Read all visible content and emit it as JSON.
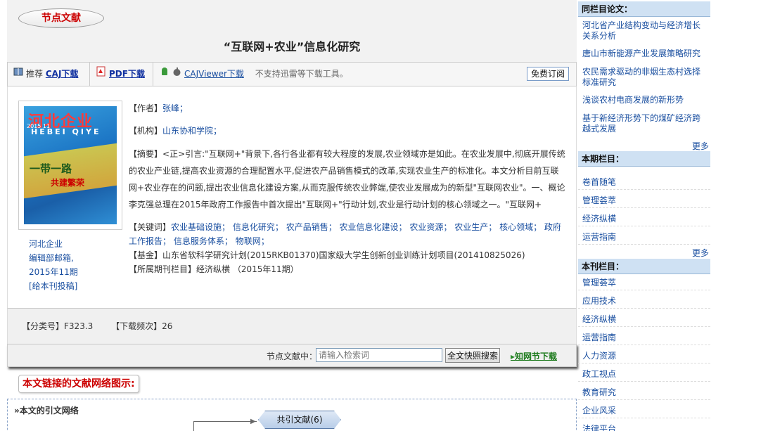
{
  "header": {
    "badge": "节点文献",
    "title": "“互联网+农业”信息化研究"
  },
  "toolbar": {
    "recommend_label": "推荐",
    "caj_download": "CAJ下载",
    "pdf_download": "PDF下载",
    "cajviewer_download": "CAJViewer下载",
    "note": "不支持迅雷等下载工具。",
    "subscribe": "免费订阅"
  },
  "detail": {
    "author_label": "【作者】",
    "author": "张峰；",
    "org_label": "【机构】",
    "org": "山东协和学院；",
    "abstract_label": "【摘要】",
    "abstract": "<正>引言:\"互联网+\"背景下,各行各业都有较大程度的发展,农业领域亦是如此。在农业发展中,彻底开展传统的农业产业链,提高农业资源的合理配置水平,促进农产品销售模式的改革,实现农业生产的标准化。本文分析目前互联网+农业存在的问题,提出农业信息化建设方案,从而克服传统农业弊端,使农业发展成为的新型\"互联网农业\"。一、概论李克强总理在2015年政府工作报告中首次提出\"互联网+\"行动计划,农业是行动计划的核心领域之一。\"互联网+",
    "keywords_label": "【关键词】",
    "keywords": [
      "农业基础设施；",
      "信息化研究；",
      "农产品销售；",
      "农业信息化建设；",
      "农业资源；",
      "农业生产；",
      "核心领域；",
      "政府工作报告；",
      "信息服务体系；",
      "物联网；"
    ],
    "fund_label": "【基金】",
    "fund": "山东省软科学研究计划(2015RKB01370)国家级大学生创新创业训练计划项目(201410825026)",
    "column_label": "【所属期刊栏目】",
    "column": "经济纵横 （2015年11期）"
  },
  "cover": {
    "logo_text": "河北企业",
    "logo_pinyin": "HEBEI QIYE",
    "issue": "2015 11",
    "slogan": "一带一路",
    "slogan2": "共建繁荣"
  },
  "publication": {
    "journal": "河北企业",
    "editor": "编辑部邮箱,",
    "issue": "2015年11期",
    "submit": "[给本刊投稿]"
  },
  "classification": {
    "class_label": "【分类号】",
    "class_value": "F323.3",
    "downloads_label": "【下载频次】",
    "downloads_value": "26"
  },
  "search": {
    "label": "节点文献中：",
    "placeholder": "请输入检索词",
    "button": "全文快照搜索",
    "cnki_link": "知网节下载"
  },
  "network": {
    "title": "本文链接的文献网络图示:",
    "subtitle": "»本文的引文网络",
    "cocite": "共引文献(6)"
  },
  "sidebar": {
    "same_column_title": "同栏目论文：",
    "same_column": [
      "河北省产业结构变动与经济增长关系分析",
      "唐山市新能源产业发展策略研究",
      "农民需求驱动的非烟生态村选择标准研究",
      "浅谈农村电商发展的新形势",
      "基于新经济形势下的煤矿经济跨越式发展"
    ],
    "more1": "更多",
    "issue_column_title": "本期栏目：",
    "issue_columns": [
      "卷首随笔",
      "管理荟萃",
      "经济纵横",
      "运营指南"
    ],
    "more2": "更多",
    "journal_column_title": "本刊栏目：",
    "journal_columns": [
      "管理荟萃",
      "应用技术",
      "经济纵横",
      "运营指南",
      "人力资源",
      "政工视点",
      "教育研究",
      "企业风采",
      "法律平台"
    ]
  }
}
